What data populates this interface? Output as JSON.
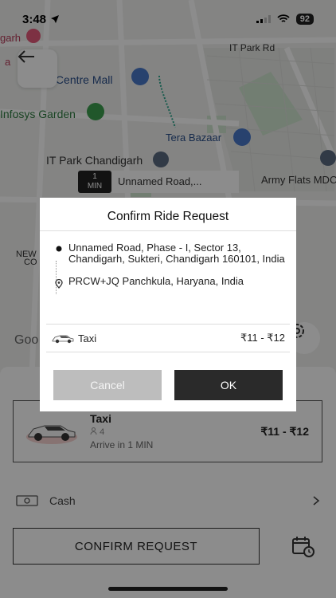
{
  "status_bar": {
    "time": "3:48",
    "battery": "92"
  },
  "map": {
    "labels": {
      "corner_partial": "garh",
      "corner_partial2": "a",
      "road": "IT Park Rd",
      "mall": "L   ty Centre Mall",
      "garden": "Infosys Garden",
      "bazaar": "Tera Bazaar",
      "it_park": "IT Park Chandigarh",
      "army": "Army Flats MDC",
      "new_partial": "NEW",
      "co_partial": "CO",
      "google": "Goo"
    },
    "eta": {
      "value": "1",
      "unit": "MIN"
    },
    "eta_destination": "Unnamed Road,..."
  },
  "dialog": {
    "title": "Confirm Ride Request",
    "pickup": "Unnamed Road, Phase - I, Sector 13, Chandigarh, Sukteri, Chandigarh 160101, India",
    "drop": "PRCW+JQ Panchkula, Haryana, India",
    "vehicle": {
      "name": "Taxi",
      "price": "₹11 - ₹12"
    },
    "cancel_label": "Cancel",
    "ok_label": "OK"
  },
  "ride_option": {
    "name": "Taxi",
    "seats": "4",
    "arrive": "Arrive in 1 MIN",
    "price": "₹11 - ₹12"
  },
  "payment": {
    "method": "Cash"
  },
  "confirm_label": "CONFIRM REQUEST",
  "colors": {
    "accent_dark": "#2a2a2a",
    "disabled": "#bdbdbd"
  }
}
